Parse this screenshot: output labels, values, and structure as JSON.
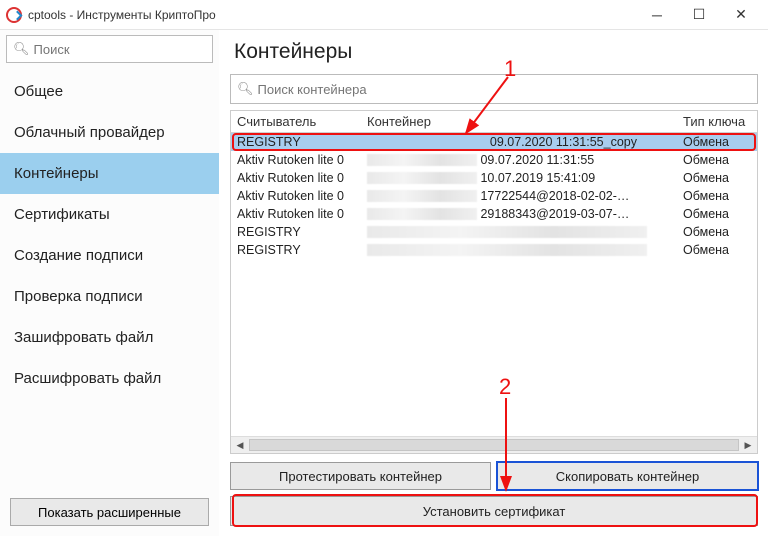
{
  "window": {
    "title": "cptools - Инструменты КриптоПро"
  },
  "sidebar": {
    "search_placeholder": "Поиск",
    "items": [
      {
        "label": "Общее"
      },
      {
        "label": "Облачный провайдер"
      },
      {
        "label": "Контейнеры"
      },
      {
        "label": "Сертификаты"
      },
      {
        "label": "Создание подписи"
      },
      {
        "label": "Проверка подписи"
      },
      {
        "label": "Зашифровать файл"
      },
      {
        "label": "Расшифровать файл"
      }
    ],
    "active_index": 2,
    "advanced_btn": "Показать расширенные"
  },
  "main": {
    "title": "Контейнеры",
    "search_placeholder": "Поиск контейнера",
    "columns": {
      "reader": "Считыватель",
      "container": "Контейнер",
      "key_type": "Тип ключа"
    },
    "rows": [
      {
        "reader": "REGISTRY",
        "container": "09.07.2020 11:31:55_copy",
        "key_type": "Обмена",
        "blur": false,
        "selected": true
      },
      {
        "reader": "Aktiv Rutoken lite 0",
        "container": "09.07.2020 11:31:55",
        "key_type": "Обмена",
        "blur": true
      },
      {
        "reader": "Aktiv Rutoken lite 0",
        "container": "10.07.2019 15:41:09",
        "key_type": "Обмена",
        "blur": true
      },
      {
        "reader": "Aktiv Rutoken lite 0",
        "container": "17722544@2018-02-02-",
        "key_type": "Обмена",
        "blur": true,
        "blur_after": true
      },
      {
        "reader": "Aktiv Rutoken lite 0",
        "container": "29188343@2019-03-07-",
        "key_type": "Обмена",
        "blur": true,
        "blur_after": true
      },
      {
        "reader": "REGISTRY",
        "container": "",
        "key_type": "Обмена",
        "blur": true,
        "full_blur": true
      },
      {
        "reader": "REGISTRY",
        "container": "",
        "key_type": "Обмена",
        "blur": true,
        "full_blur": true
      }
    ],
    "buttons": {
      "test": "Протестировать контейнер",
      "copy": "Скопировать контейнер",
      "install": "Установить сертификат"
    }
  },
  "annotations": {
    "label1": "1",
    "label2": "2"
  }
}
